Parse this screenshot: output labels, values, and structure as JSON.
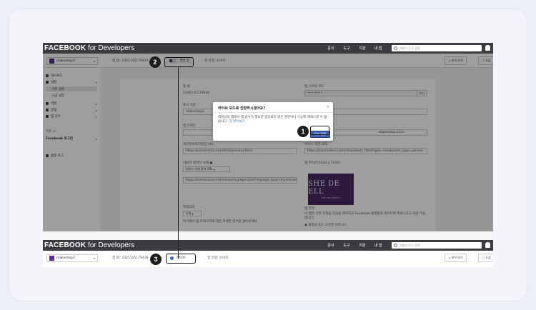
{
  "top": {
    "brand_bold": "FACEBOOK",
    "brand_rest": " for Developers",
    "nav": [
      "문서",
      "도구",
      "지원",
      "내 앱"
    ],
    "search_placeholder": "개발자 문서 검색"
  },
  "sub": {
    "app_name": "makeshop2",
    "app_id_label": "앱 ID:",
    "app_id": "2345145179420",
    "app_id_full": "2345145179438",
    "toggle_dev": "개발 중",
    "toggle_live": "라이브",
    "status_label": "앱 유형:",
    "status_value": "소비자",
    "btn_analytics": "분석 보기",
    "btn_help": "도움"
  },
  "sidebar": {
    "dashboard": "대시보드",
    "settings": "설정",
    "basic": "기본 설정",
    "advanced": "고급 설정",
    "roles": "역할",
    "alerts": "알림",
    "app_review": "앱 검수",
    "products_label": "제품",
    "fb_login": "Facebook 로그인",
    "activity_log": "활동 로그"
  },
  "form": {
    "app_id_label": "앱 ID",
    "app_id_value": "2345145179420",
    "secret_label": "앱 시크릿 코드",
    "secret_value": "••••••••",
    "secret_btn": "보기",
    "display_name_label": "표시 이름",
    "display_name_value": "makeshop2",
    "domain_label": "앱 도메인",
    "contact_value": "makeshop.co.kr",
    "privacy_label": "개인정보처리방침 URL",
    "privacy_value": "https://cocenstore.com/html/privacy.html",
    "terms_label": "서비스 약관 URL",
    "terms_value": "https://cocenstore.com/shop/dantc.html?type=new&mem_type=person",
    "deletion_label": "사용자 데이터 삭제",
    "deletion_select": "데이터 삭제 콜백 URL",
    "deletion_value": "https://cocenstore.com/shop/mypage.html?mypage_type=myexituser",
    "icon_label": "앱 아이콘(1024 x 1024)",
    "category_label": "카테고리",
    "category_select": "쇼핑",
    "category_help": "여기에서 앱 카테고리에 대한 자세한 정보를 참아보세요",
    "license_label": "앱 목적",
    "license_text": "이 앱의 기본 목적을 다음을 제외하고 Facebook 플랫폼의 데이터에 액세스하고 이용 가능합니다.",
    "license_sub": "회원님 또는 소유한 비즈니스"
  },
  "logo": {
    "line1": "SHE DE ELL",
    "line2": "THE GIRL SPECIAL"
  },
  "modal": {
    "title": "라이브 모드로 전환하시겠어요?",
    "body": "회원님의 앱에서 앱 검수가 필요한 승인되지 않은 권한이나 기능에 액세스할 수 없습니다.",
    "link": "더 알아보기",
    "confirm": "모드 전환",
    "close": "×"
  },
  "badges": [
    "1",
    "2",
    "3"
  ]
}
